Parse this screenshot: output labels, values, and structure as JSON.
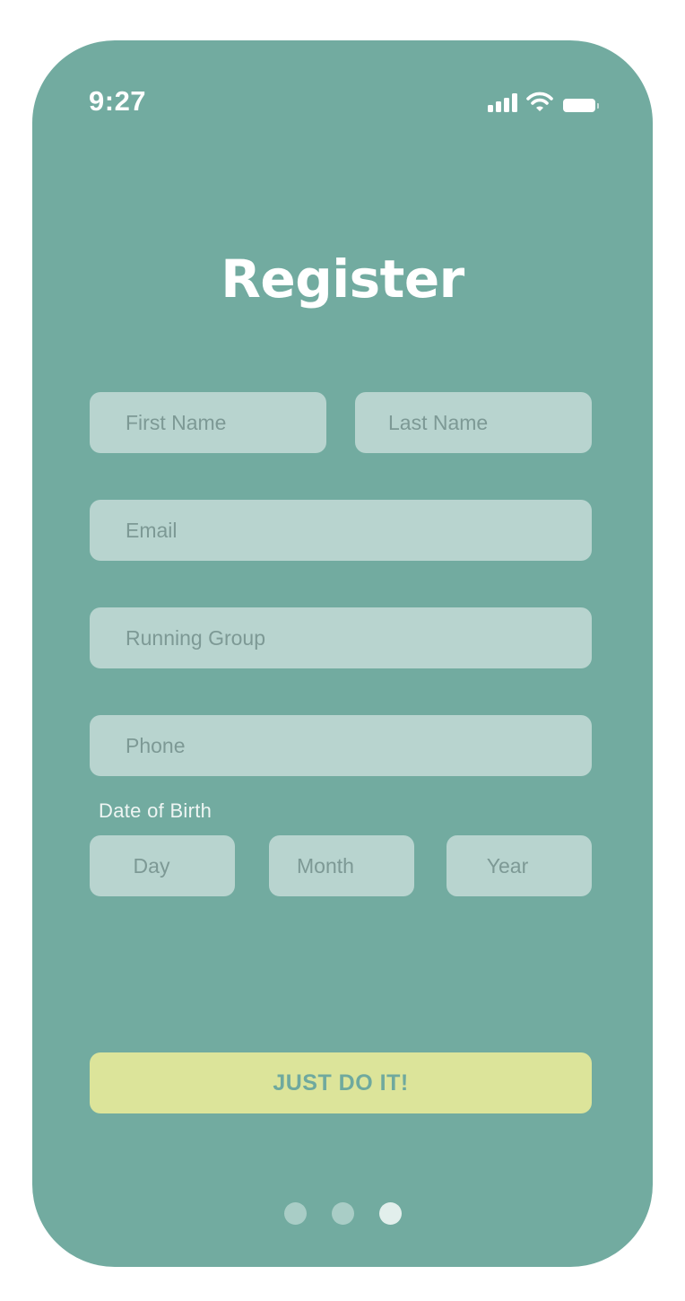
{
  "status_bar": {
    "time": "9:27",
    "icons": [
      "cellular-signal-icon",
      "wifi-icon",
      "battery-icon"
    ]
  },
  "title": "Register",
  "fields": {
    "first_name": {
      "placeholder": "First Name",
      "value": ""
    },
    "last_name": {
      "placeholder": "Last Name",
      "value": ""
    },
    "email": {
      "placeholder": "Email",
      "value": ""
    },
    "running_group": {
      "placeholder": "Running Group",
      "value": ""
    },
    "phone": {
      "placeholder": "Phone",
      "value": ""
    }
  },
  "date_of_birth": {
    "label": "Date of Birth",
    "day_placeholder": "Day",
    "month_placeholder": "Month",
    "year_placeholder": "Year"
  },
  "submit_label": "JUST DO IT!",
  "pager": {
    "total": 3,
    "active_index": 2
  },
  "colors": {
    "background": "#72aba0",
    "field": "#b8d4cf",
    "button": "#dce49a",
    "button_text": "#6fa99e"
  }
}
